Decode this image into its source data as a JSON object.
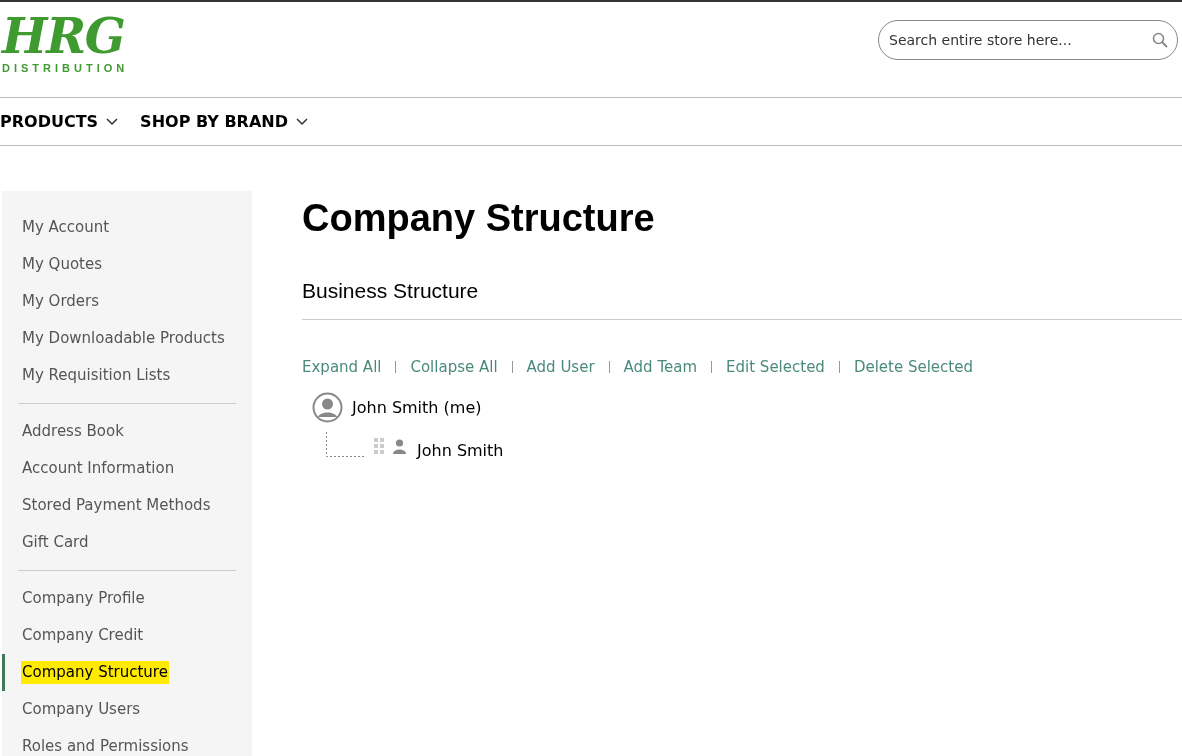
{
  "logo": {
    "wordmark": "HRG",
    "tagline": "DISTRIBUTION"
  },
  "search": {
    "placeholder": "Search entire store here..."
  },
  "nav": [
    {
      "label": "PRODUCTS"
    },
    {
      "label": "SHOP BY BRAND"
    }
  ],
  "sidebar": {
    "groups": [
      {
        "items": [
          {
            "label": "My Account",
            "selected": false
          },
          {
            "label": "My Quotes",
            "selected": false
          },
          {
            "label": "My Orders",
            "selected": false
          },
          {
            "label": "My Downloadable Products",
            "selected": false
          },
          {
            "label": "My Requisition Lists",
            "selected": false
          }
        ]
      },
      {
        "items": [
          {
            "label": "Address Book",
            "selected": false
          },
          {
            "label": "Account Information",
            "selected": false
          },
          {
            "label": "Stored Payment Methods",
            "selected": false
          },
          {
            "label": "Gift Card",
            "selected": false
          }
        ]
      },
      {
        "items": [
          {
            "label": "Company Profile",
            "selected": false
          },
          {
            "label": "Company Credit",
            "selected": false
          },
          {
            "label": "Company Structure",
            "selected": true
          },
          {
            "label": "Company Users",
            "selected": false
          },
          {
            "label": "Roles and Permissions",
            "selected": false
          }
        ]
      }
    ]
  },
  "page_title": "Company Structure",
  "section_title": "Business Structure",
  "actions": [
    "Expand All",
    "Collapse All",
    "Add User",
    "Add Team",
    "Edit Selected",
    "Delete Selected"
  ],
  "tree": [
    {
      "name": "John Smith (me)",
      "children": [
        {
          "name": "John Smith"
        }
      ]
    }
  ]
}
